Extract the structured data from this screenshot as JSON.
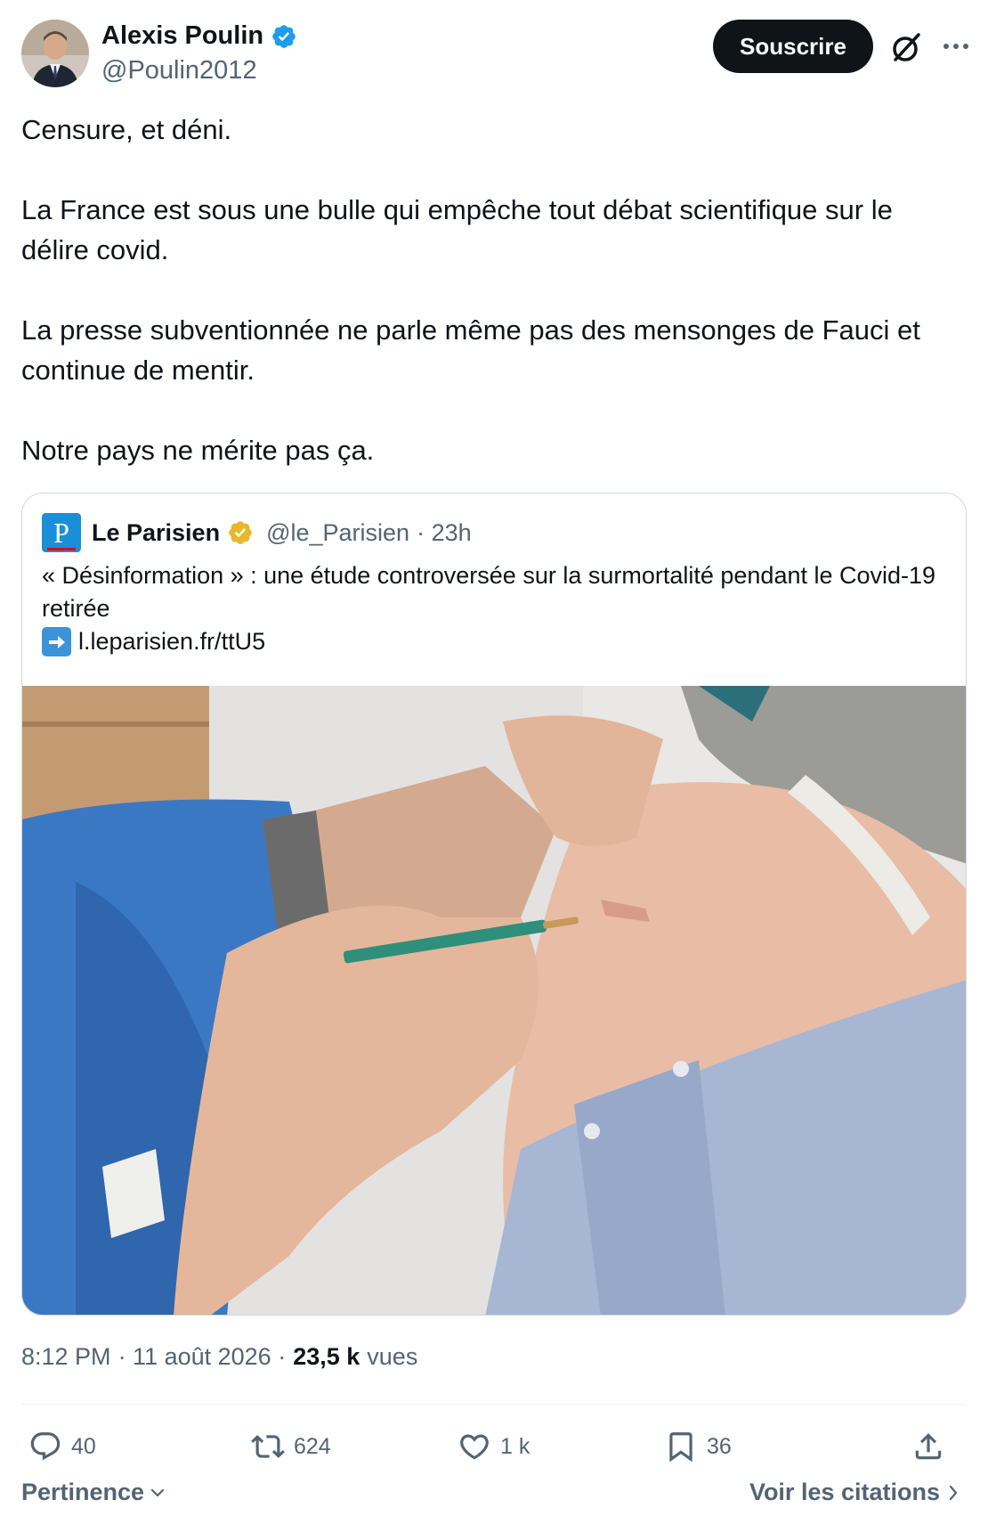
{
  "author": {
    "display_name": "Alexis Poulin",
    "handle": "@Poulin2012",
    "verified": true,
    "verified_color": "#1d9bf0"
  },
  "header": {
    "subscribe_label": "Souscrire",
    "grok_icon": "grok-icon",
    "more_icon": "more-icon"
  },
  "tweet": {
    "paragraphs": [
      "Censure, et déni.",
      "La France est sous une bulle qui empêche tout débat scientifique sur le délire covid.",
      "La presse subventionnée ne parle même pas des mensonges de Fauci et continue de mentir.",
      "Notre pays ne mérite pas ça."
    ]
  },
  "quoted": {
    "name": "Le Parisien",
    "verified_color": "#e8b829",
    "handle": "@le_Parisien",
    "time": "· 23h",
    "text": "« Désinformation » : une étude controversée sur la surmortalité pendant le Covid-19 retirée",
    "link": "l.leparisien.fr/ttU5",
    "image_description": "vaccination-photo"
  },
  "meta": {
    "time": "8:12 PM",
    "date": "· 11 août 2026 ·",
    "views_count": "23,5 k",
    "views_label": "vues"
  },
  "actions": {
    "replies": "40",
    "reposts": "624",
    "likes": "1 k",
    "bookmarks": "36"
  },
  "footer": {
    "sort_label": "Pertinence",
    "quotes_label": "Voir les citations"
  },
  "colors": {
    "text": "#0f1419",
    "secondary": "#536471",
    "border": "#cfd9de",
    "button_bg": "#0f1419"
  }
}
